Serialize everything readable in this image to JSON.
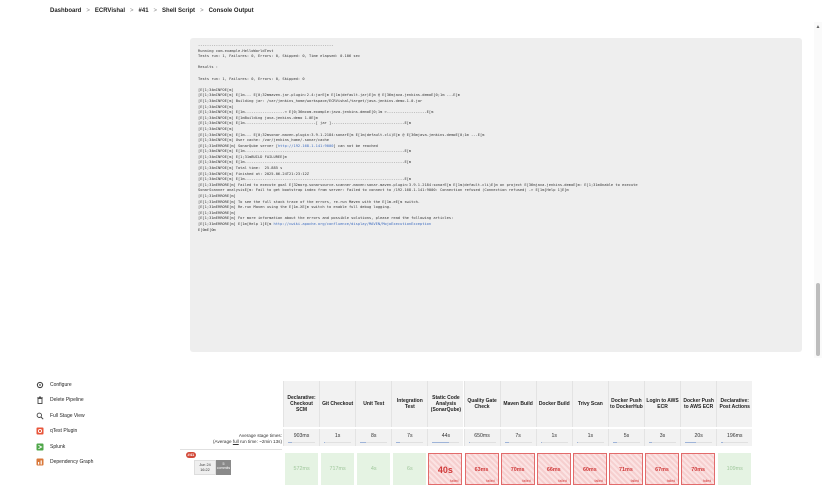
{
  "breadcrumb": [
    "Dashboard",
    "ECRVishal",
    "#41",
    "Shell Script",
    "Console Output"
  ],
  "console_lines": [
    "-------------------------------------------------------------",
    "Running com.example.HelloWorldTest",
    "Tests run: 1, Failures: 0, Errors: 0, Skipped: 0, Time elapsed: 0.106 sec",
    "",
    "Results :",
    "",
    "Tests run: 1, Failures: 0, Errors: 0, Skipped: 0",
    "",
    "[E[1;34mINFOE[m]",
    "[E[1;34mINFOE[m] E[1m--- E[0;32mmaven-jar-plugin:2.4:jarE[m E[1m(default-jar)E[m @ E[36mjava-jenkins-demoE[0;1m ---E[m",
    "[E[1;34mINFOE[m] Building jar: /var/jenkins_home/workspace/ECRVishal/target/java-jenkins-demo-1.0.jar",
    "[E[1;34mINFOE[m]",
    "[E[1;34mINFOE[m] E[1m------------------< E[0;36mcom.example:java-jenkins-demoE[0;1m >------------------E[m",
    "[E[1;34mINFOE[m] E[1mBuilding java-jenkins-demo 1.0E[m",
    "[E[1;34mINFOE[m] E[1m--------------------------------[ jar ]---------------------------------E[m",
    "[E[1;34mINFOE[m]",
    "[E[1;34mINFOE[m] E[1m--- E[0;32msonar-maven-plugin:3.9.1.2184:sonarE[m E[1m(default-cli)E[m @ E[36mjava-jenkins-demoE[0;1m ---E[m",
    "[E[1;34mINFOE[m] User cache: /var/jenkins_home/.sonar/cache",
    "[E[1;31mERRORE[m] SonarQube server [",
    "[E[1;34mINFOE[m] E[1m------------------------------------------------------------------------E[m",
    "[E[1;34mINFOE[m] E[1;31mBUILD FAILUREE[m",
    "[E[1;34mINFOE[m] E[1m------------------------------------------------------------------------E[m",
    "[E[1;34mINFOE[m] Total time:  25.885 s",
    "[E[1;34mINFOE[m] Finished at: 2025-06-24T21:23:12Z",
    "[E[1;34mINFOE[m] E[1m------------------------------------------------------------------------E[m",
    "[E[1;31mERRORE[m] Failed to execute goal E[32morg.sonarsource.scanner.maven:sonar-maven-plugin:3.9.1.2184:sonarE[m E[1m(default-cli)E[m on project E[36mjava-jenkins-demoE[m: E[1;31mUnable to execute",
    "SonarScanner analysisE[m: Fail to get bootstrap index from server: Failed to connect to /192.168.1.141:9000: Connection refused (Connection refused) -> E[1m[Help 1]E[m",
    "[E[1;31mERRORE[m]",
    "[E[1;31mERRORE[m] To see the full stack trace of the errors, re-run Maven with the E[1m-eE[m switch.",
    "[E[1;31mERRORE[m] Re-run Maven using the E[1m-XE[m switch to enable full debug logging.",
    "[E[1;31mERRORE[m]",
    "[E[1;31mERRORE[m] For more information about the errors and possible solutions, please read the following articles:",
    "[E[1;31mERRORE[m] E[1m[Help 1]E[m ",
    "E[0mE[0m"
  ],
  "console_links": {
    "sonar_url": "http://192.168.1.141:9000",
    "sonar_suffix": "] can not be reached",
    "help_url": "http://cwiki.apache.org/confluence/display/MAVEN/MojoExecutionException"
  },
  "sidebar": [
    {
      "label": "Configure",
      "icon": "gear-icon"
    },
    {
      "label": "Delete Pipeline",
      "icon": "trash-icon"
    },
    {
      "label": "Full Stage View",
      "icon": "search-icon"
    },
    {
      "label": "qTest Plugin",
      "icon": "qtest-icon"
    },
    {
      "label": "Splunk",
      "icon": "splunk-icon"
    },
    {
      "label": "Dependency Graph",
      "icon": "graph-icon"
    }
  ],
  "stage_view": {
    "average_label": "Average stage times:",
    "average_sub_prefix": "(Average ",
    "average_sub_link": "full",
    "average_sub_suffix": " run time: ~2min 13s)",
    "stages": [
      {
        "name": "Declarative: Checkout SCM",
        "avg": "903ms",
        "avg_frac": 0.15,
        "result": "572ms",
        "status": "success"
      },
      {
        "name": "Git Checkout",
        "avg": "1s",
        "avg_frac": 0.05,
        "result": "717ms",
        "status": "success"
      },
      {
        "name": "Unit Test",
        "avg": "8s",
        "avg_frac": 0.2,
        "result": "4s",
        "status": "success"
      },
      {
        "name": "Integration Test",
        "avg": "7s",
        "avg_frac": 0.15,
        "result": "6s",
        "status": "success"
      },
      {
        "name": "Static Code Analysis (SonarQube)",
        "avg": "44s",
        "avg_frac": 0.6,
        "result": "40s",
        "status": "failed",
        "big": true
      },
      {
        "name": "Quality Gate Check",
        "avg": "650ms",
        "avg_frac": 0.05,
        "result": "63ms",
        "status": "failed"
      },
      {
        "name": "Maven Build",
        "avg": "7s",
        "avg_frac": 0.15,
        "result": "70ms",
        "status": "failed"
      },
      {
        "name": "Docker Build",
        "avg": "1s",
        "avg_frac": 0.05,
        "result": "66ms",
        "status": "failed"
      },
      {
        "name": "Trivy Scan",
        "avg": "1s",
        "avg_frac": 0.05,
        "result": "60ms",
        "status": "failed"
      },
      {
        "name": "Docker Push to DockerHub",
        "avg": "5s",
        "avg_frac": 0.15,
        "result": "71ms",
        "status": "failed"
      },
      {
        "name": "Login to AWS ECR",
        "avg": "3s",
        "avg_frac": 0.1,
        "result": "67ms",
        "status": "failed"
      },
      {
        "name": "Docker Push to AWS ECR",
        "avg": "20s",
        "avg_frac": 0.4,
        "result": "70ms",
        "status": "failed"
      },
      {
        "name": "Declarative: Post Actions",
        "avg": "196ms",
        "avg_frac": 0.05,
        "result": "109ms",
        "status": "success"
      }
    ],
    "failed_label": "failed",
    "run": {
      "number": "#41",
      "date": "Jun 24",
      "time": "16:22",
      "commits_count": "5",
      "commits_label": "commits"
    }
  },
  "colors": {
    "failed": "#d03a3a",
    "success_bg": "#e5f3e3",
    "badge": "#d24939"
  }
}
